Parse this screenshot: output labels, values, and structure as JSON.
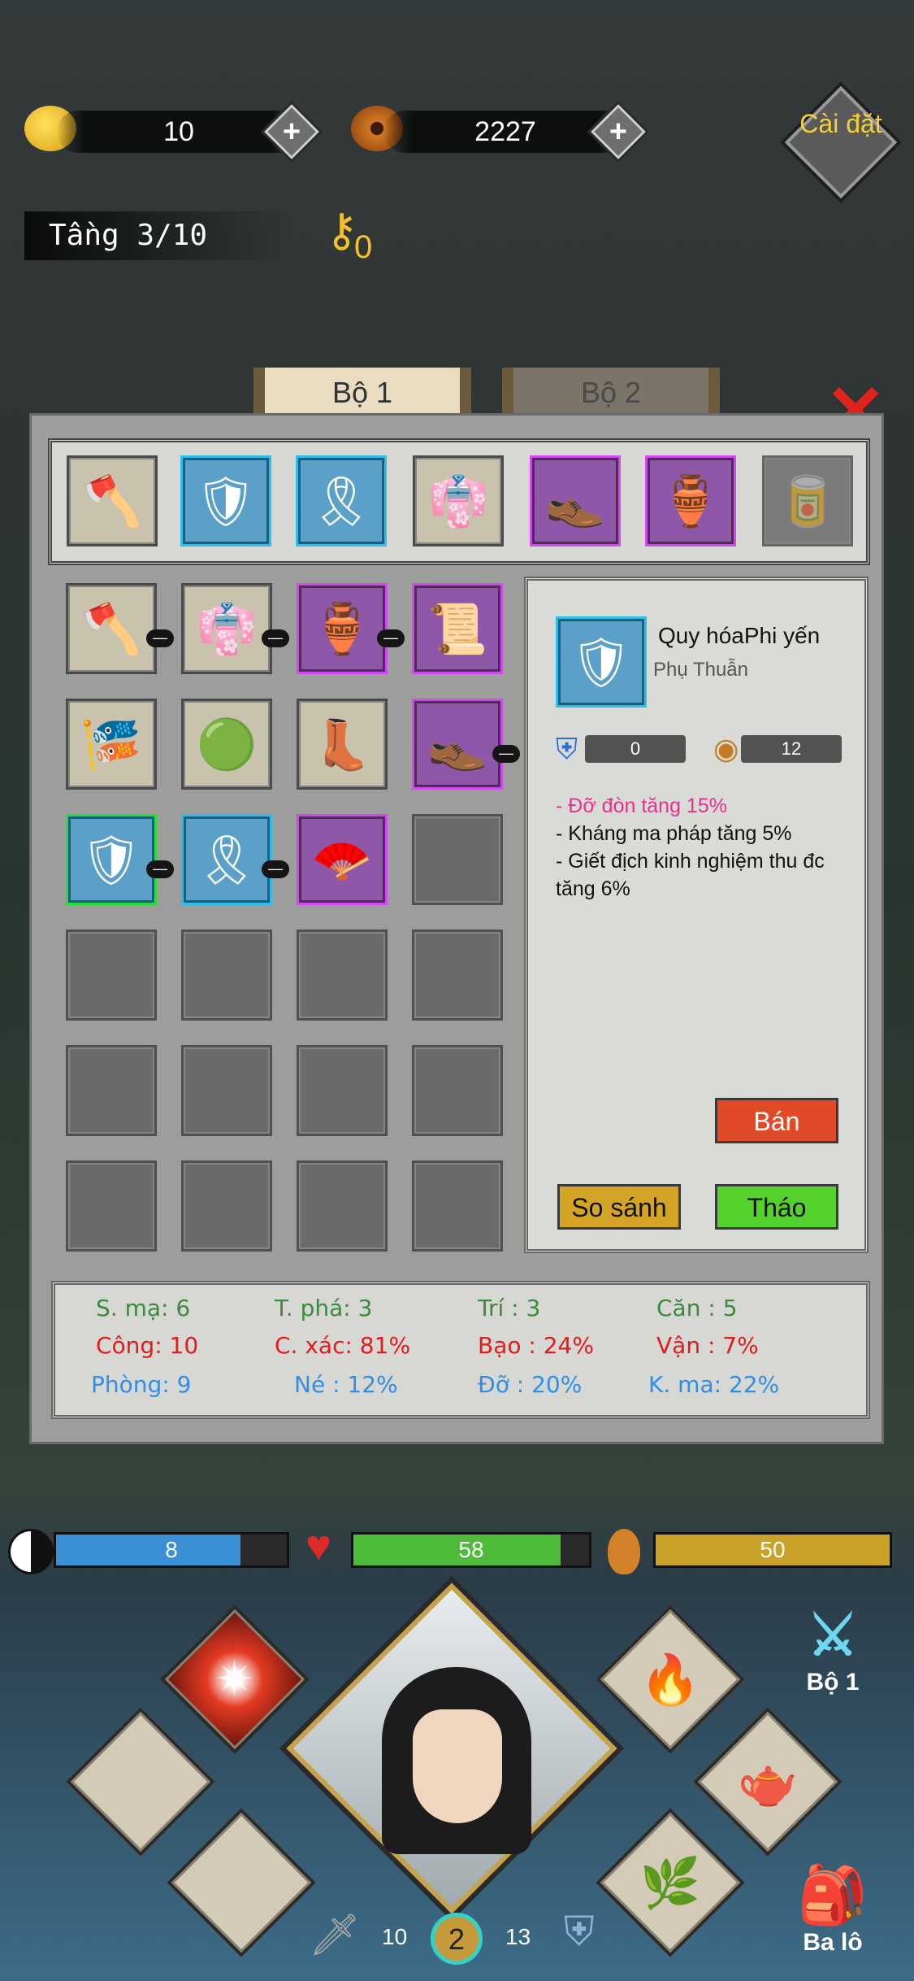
{
  "currency": {
    "gold": "10",
    "coins": "2227",
    "plus": "+"
  },
  "settings_label": "Cài đặt",
  "floor": "Tầng 3/10",
  "keys": "0",
  "tabs": {
    "set1": "Bộ 1",
    "set2": "Bộ 2"
  },
  "detail": {
    "name": "Quy hóaPhi yến",
    "type": "Phụ Thuẫn",
    "defense": "0",
    "price": "12",
    "effects": [
      "- Đỡ đòn tăng 15%",
      "- Kháng ma pháp tăng 5%",
      "- Giết địch kinh nghiệm thu đc tăng 6%"
    ],
    "sell": "Bán",
    "compare": "So sánh",
    "remove": "Tháo"
  },
  "stats": {
    "row1": [
      "S. mạ: 6",
      "T. phá: 3",
      "Trí : 3",
      "Căn : 5"
    ],
    "row2": [
      "Công: 10",
      "C. xác: 81%",
      "Bạo : 24%",
      "Vận : 7%"
    ],
    "row3": [
      "Phòng: 9",
      "Né : 12%",
      "Đỡ : 20%",
      "K. ma: 22%"
    ]
  },
  "bars": {
    "mana": {
      "value": "8",
      "fill": 0.8,
      "color": "#3b8fd4"
    },
    "hp": {
      "value": "58",
      "fill": 0.88,
      "color": "#4fbb3a"
    },
    "food": {
      "value": "50",
      "fill": 1.0,
      "color": "#c9a22a"
    }
  },
  "hero": {
    "attack": "10",
    "level": "2",
    "defense": "13"
  },
  "side_buttons": {
    "set": "Bộ 1",
    "bag": "Ba lô"
  },
  "dash": "—",
  "colors": {
    "blue_rarity": "#2ebde6",
    "purple_rarity": "#d048f0",
    "green_selected": "#22e036"
  }
}
